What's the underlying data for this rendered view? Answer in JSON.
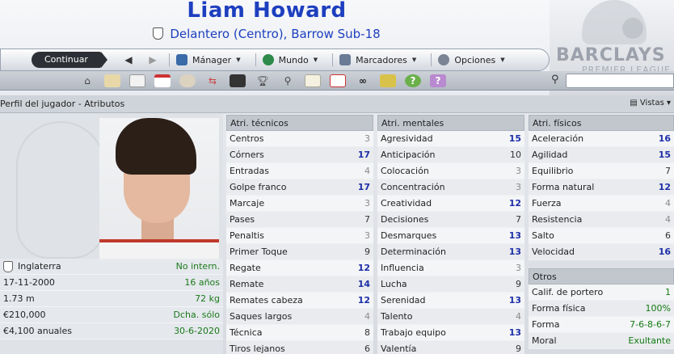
{
  "header": {
    "player_name": "Liam Howard",
    "position_club": "Delantero (Centro), Barrow Sub-18",
    "sponsor_brand": "BARCLAYS",
    "sponsor_league": "PREMIER LEAGUE"
  },
  "nav": {
    "continue_label": "Continuar",
    "back_arrow": "◀",
    "forward_arrow": "▶",
    "menus": [
      {
        "label": "Mánager",
        "icon": "manager-icon"
      },
      {
        "label": "Mundo",
        "icon": "globe-icon"
      },
      {
        "label": "Marcadores",
        "icon": "bookmarks-icon"
      },
      {
        "label": "Opciones",
        "icon": "options-icon"
      }
    ]
  },
  "toolbar": {
    "icons": [
      "home-icon",
      "inbox-icon",
      "news-icon",
      "calendar-icon",
      "squad-icon",
      "transfer-icon",
      "tactics-icon",
      "trophy-icon",
      "scouting-icon",
      "clipboard-icon",
      "medical-icon",
      "binoculars-icon",
      "finance-icon",
      "help-icon",
      "question-icon"
    ]
  },
  "title": {
    "text": "Perfil del jugador - Atributos",
    "views_label": "Vistas"
  },
  "player": {
    "info": [
      {
        "label": "Inglaterra",
        "value": "No intern.",
        "flag": true
      },
      {
        "label": "17-11-2000",
        "value": "16 años"
      },
      {
        "label": "1.73 m",
        "value": "72 kg"
      },
      {
        "label": "€210,000",
        "value": "Dcha. sólo"
      },
      {
        "label": "€4,100 anuales",
        "value": "30-6-2020"
      }
    ]
  },
  "technical": {
    "heading": "Atri. técnicos",
    "items": [
      {
        "name": "Centros",
        "value": "3",
        "tone": "grey"
      },
      {
        "name": "Córners",
        "value": "17",
        "tone": "blue"
      },
      {
        "name": "Entradas",
        "value": "4",
        "tone": "grey"
      },
      {
        "name": "Golpe franco",
        "value": "17",
        "tone": "blue"
      },
      {
        "name": "Marcaje",
        "value": "3",
        "tone": "grey"
      },
      {
        "name": "Pases",
        "value": "7",
        "tone": "dark"
      },
      {
        "name": "Penaltis",
        "value": "3",
        "tone": "grey"
      },
      {
        "name": "Primer Toque",
        "value": "9",
        "tone": "dark"
      },
      {
        "name": "Regate",
        "value": "12",
        "tone": "blue"
      },
      {
        "name": "Remate",
        "value": "14",
        "tone": "blue"
      },
      {
        "name": "Remates cabeza",
        "value": "12",
        "tone": "blue"
      },
      {
        "name": "Saques largos",
        "value": "4",
        "tone": "grey"
      },
      {
        "name": "Técnica",
        "value": "8",
        "tone": "dark"
      },
      {
        "name": "Tiros lejanos",
        "value": "6",
        "tone": "dark"
      }
    ]
  },
  "mental": {
    "heading": "Atri. mentales",
    "items": [
      {
        "name": "Agresividad",
        "value": "15",
        "tone": "blue"
      },
      {
        "name": "Anticipación",
        "value": "10",
        "tone": "dark"
      },
      {
        "name": "Colocación",
        "value": "3",
        "tone": "grey"
      },
      {
        "name": "Concentración",
        "value": "3",
        "tone": "grey"
      },
      {
        "name": "Creatividad",
        "value": "12",
        "tone": "blue"
      },
      {
        "name": "Decisiones",
        "value": "7",
        "tone": "dark"
      },
      {
        "name": "Desmarques",
        "value": "13",
        "tone": "blue"
      },
      {
        "name": "Determinación",
        "value": "13",
        "tone": "blue"
      },
      {
        "name": "Influencia",
        "value": "3",
        "tone": "grey"
      },
      {
        "name": "Lucha",
        "value": "9",
        "tone": "dark"
      },
      {
        "name": "Serenidad",
        "value": "13",
        "tone": "blue"
      },
      {
        "name": "Talento",
        "value": "4",
        "tone": "grey"
      },
      {
        "name": "Trabajo equipo",
        "value": "13",
        "tone": "blue"
      },
      {
        "name": "Valentía",
        "value": "9",
        "tone": "dark"
      }
    ]
  },
  "physical": {
    "heading": "Atri. físicos",
    "items": [
      {
        "name": "Aceleración",
        "value": "16",
        "tone": "blue"
      },
      {
        "name": "Agilidad",
        "value": "15",
        "tone": "blue"
      },
      {
        "name": "Equilibrio",
        "value": "7",
        "tone": "dark"
      },
      {
        "name": "Forma natural",
        "value": "12",
        "tone": "blue"
      },
      {
        "name": "Fuerza",
        "value": "4",
        "tone": "grey"
      },
      {
        "name": "Resistencia",
        "value": "4",
        "tone": "grey"
      },
      {
        "name": "Salto",
        "value": "6",
        "tone": "dark"
      },
      {
        "name": "Velocidad",
        "value": "16",
        "tone": "blue"
      }
    ]
  },
  "others": {
    "heading": "Otros",
    "items": [
      {
        "name": "Calif. de portero",
        "value": "1",
        "tone": "green"
      },
      {
        "name": "Forma física",
        "value": "100%",
        "tone": "green"
      },
      {
        "name": "Forma",
        "value": "7-6-8-6-7",
        "tone": "green"
      },
      {
        "name": "Moral",
        "value": "Exultante",
        "tone": "green"
      }
    ]
  },
  "colors": {
    "accent": "#1d3fbf",
    "high_value": "#1d2fa8",
    "green_value": "#137a13"
  }
}
